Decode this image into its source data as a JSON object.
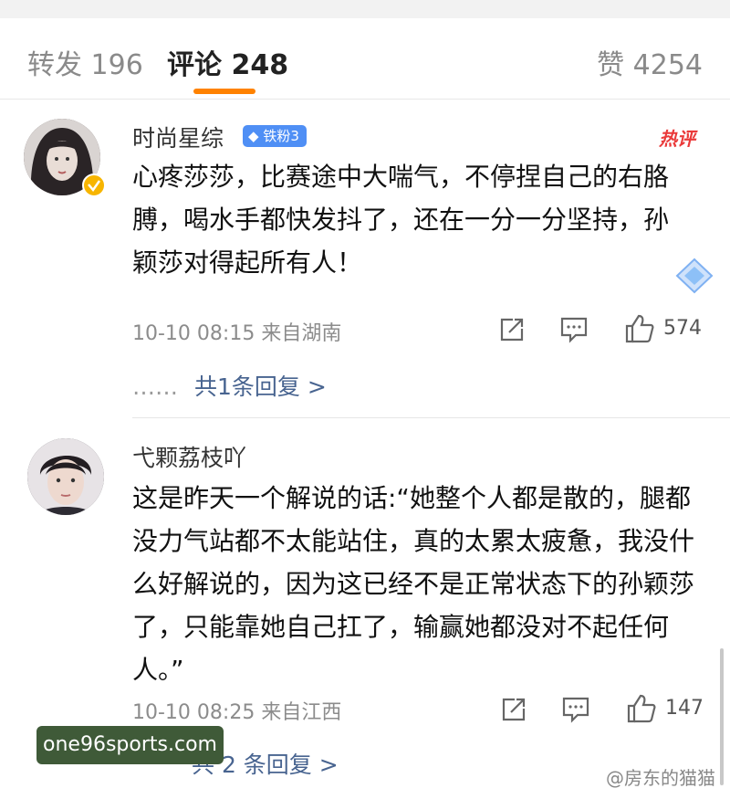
{
  "tabs": {
    "reposts": "转发 196",
    "comments": "评论 248",
    "likes": "赞 4254"
  },
  "colors": {
    "accent": "#ff8200",
    "link": "#486490",
    "hot": "#ea3a3a",
    "badge": "#4f8ff5"
  },
  "comments": [
    {
      "user": "时尚星综",
      "badge": "铁粉3",
      "hot_tag": "热评",
      "text": "心疼莎莎，比赛途中大喘气，不停捏自己的右胳膊，喝水手都快发抖了，还在一分一分坚持，孙颖莎对得起所有人！",
      "meta": "10-10 08:15 来自湖南",
      "likes": "574",
      "replies_dots": "……",
      "replies": "共1条回复 >"
    },
    {
      "user": "弋颗荔枝吖",
      "text": "这是昨天一个解说的话:“她整个人都是散的，腿都没力气站都不太能站住，真的太累太疲惫，我没什么好解说的，因为这已经不是正常状态下的孙颖莎了，只能靠她自己扛了，输赢她都没对不起任何人。”",
      "meta": "10-10 08:25 来自江西",
      "likes": "147",
      "replies": "共 2 条回复 >"
    }
  ],
  "watermark": "one96sports.com",
  "corner_mark": "@房东的猫猫",
  "icons": [
    "repost-icon",
    "comment-icon",
    "like-icon",
    "verified-icon",
    "diamond-icon"
  ]
}
